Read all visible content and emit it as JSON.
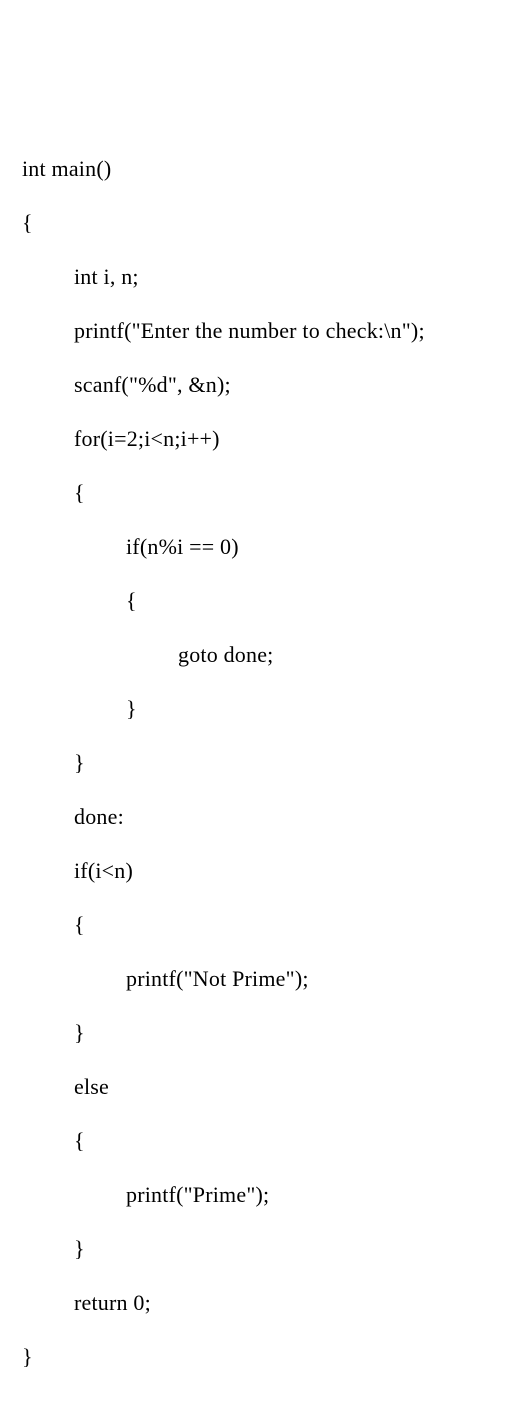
{
  "code": {
    "l1": "int main()",
    "l2": "{",
    "l3": "int i, n;",
    "l4": "printf(\"Enter the number to check:\\n\");",
    "l5": "scanf(\"%d\", &n);",
    "l6": "for(i=2;i<n;i++)",
    "l7": "{",
    "l8": "if(n%i == 0)",
    "l9": "{",
    "l10": "goto done;",
    "l11": "}",
    "l12": "}",
    "l13": "done:",
    "l14": "if(i<n)",
    "l15": "{",
    "l16": "printf(\"Not Prime\");",
    "l17": "}",
    "l18": "else",
    "l19": "{",
    "l20": "printf(\"Prime\");",
    "l21": "}",
    "l22": "return 0;",
    "l23": "}"
  }
}
